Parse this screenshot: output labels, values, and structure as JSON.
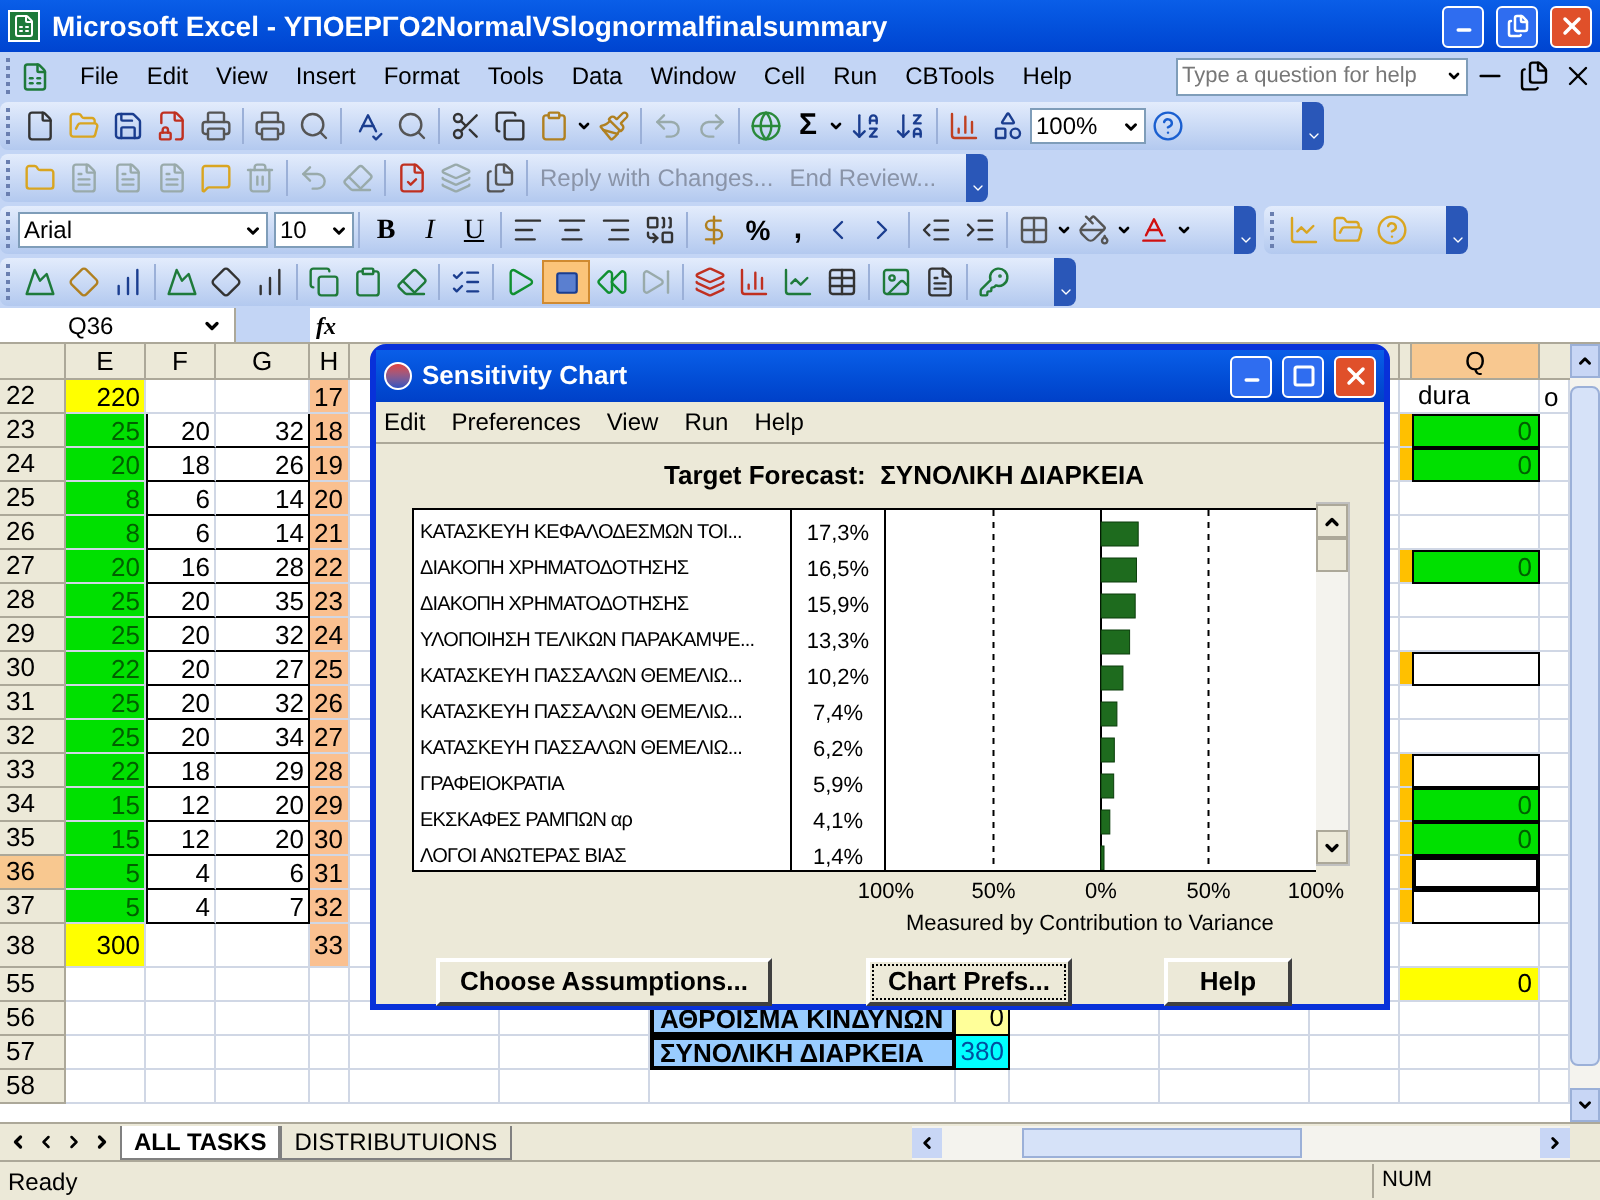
{
  "window": {
    "title": "Microsoft Excel - ΥΠΟΕΡΓΟ2NormalVSlognormalfinalsummary"
  },
  "menu_bar": {
    "items": [
      "File",
      "Edit",
      "View",
      "Insert",
      "Format",
      "Tools",
      "Data",
      "Window",
      "Cell",
      "Run",
      "CBTools",
      "Help"
    ],
    "help_search": {
      "placeholder": "Type a question for help"
    }
  },
  "standard_toolbar": {
    "autosum": "Σ",
    "zoom": "100%"
  },
  "reviewing_toolbar": {
    "reply": "Reply with Changes...",
    "end_review": "End Review..."
  },
  "formatting_toolbar": {
    "font": "Arial",
    "size": "10",
    "style_buttons": [
      "B",
      "I",
      "U"
    ],
    "percent": "%",
    "comma": ","
  },
  "simulation_toolbar": {
    "stop_pressed": true
  },
  "formula_bar": {
    "name_box": "Q36",
    "fx": "fx"
  },
  "sheet": {
    "columns": [
      {
        "label": "E",
        "selected": false
      },
      {
        "label": "F",
        "selected": false
      },
      {
        "label": "G",
        "selected": false
      },
      {
        "label": "H",
        "selected": false
      }
    ],
    "right_columns": [
      {
        "label": "Q",
        "selected": true
      }
    ],
    "rows": [
      {
        "header": "22",
        "selected": false,
        "e": {
          "value": "220",
          "kind": "total"
        },
        "h": "17",
        "q": {
          "kind": "text",
          "value": "dura"
        },
        "r": "o"
      },
      {
        "header": "23",
        "selected": false,
        "e": {
          "value": "25",
          "kind": "task"
        },
        "f": "20",
        "g": "32",
        "h": "18",
        "q": {
          "kind": "green",
          "value": "0"
        }
      },
      {
        "header": "24",
        "selected": false,
        "e": {
          "value": "20",
          "kind": "task"
        },
        "f": "18",
        "g": "26",
        "h": "19",
        "q": {
          "kind": "green",
          "value": "0"
        }
      },
      {
        "header": "25",
        "selected": false,
        "e": {
          "value": "8",
          "kind": "task"
        },
        "f": "6",
        "g": "14",
        "h": "20"
      },
      {
        "header": "26",
        "selected": false,
        "e": {
          "value": "8",
          "kind": "task"
        },
        "f": "6",
        "g": "14",
        "h": "21"
      },
      {
        "header": "27",
        "selected": false,
        "e": {
          "value": "20",
          "kind": "task"
        },
        "f": "16",
        "g": "28",
        "h": "22",
        "q": {
          "kind": "green",
          "value": "0"
        }
      },
      {
        "header": "28",
        "selected": false,
        "e": {
          "value": "25",
          "kind": "task"
        },
        "f": "20",
        "g": "35",
        "h": "23"
      },
      {
        "header": "29",
        "selected": false,
        "e": {
          "value": "25",
          "kind": "task"
        },
        "f": "20",
        "g": "32",
        "h": "24"
      },
      {
        "header": "30",
        "selected": false,
        "e": {
          "value": "22",
          "kind": "task"
        },
        "f": "20",
        "g": "27",
        "h": "25",
        "q": {
          "kind": "box"
        }
      },
      {
        "header": "31",
        "selected": false,
        "e": {
          "value": "25",
          "kind": "task"
        },
        "f": "20",
        "g": "32",
        "h": "26"
      },
      {
        "header": "32",
        "selected": false,
        "e": {
          "value": "25",
          "kind": "task"
        },
        "f": "20",
        "g": "34",
        "h": "27"
      },
      {
        "header": "33",
        "selected": false,
        "e": {
          "value": "22",
          "kind": "task"
        },
        "f": "18",
        "g": "29",
        "h": "28",
        "q": {
          "kind": "box"
        }
      },
      {
        "header": "34",
        "selected": false,
        "e": {
          "value": "15",
          "kind": "task"
        },
        "f": "12",
        "g": "20",
        "h": "29",
        "q": {
          "kind": "green",
          "value": "0"
        }
      },
      {
        "header": "35",
        "selected": false,
        "e": {
          "value": "15",
          "kind": "task"
        },
        "f": "12",
        "g": "20",
        "h": "30",
        "q": {
          "kind": "green",
          "value": "0"
        }
      },
      {
        "header": "36",
        "selected": true,
        "e": {
          "value": "5",
          "kind": "task"
        },
        "f": "4",
        "g": "6",
        "h": "31",
        "q": {
          "kind": "box"
        }
      },
      {
        "header": "37",
        "selected": false,
        "e": {
          "value": "5",
          "kind": "task"
        },
        "f": "4",
        "g": "7",
        "h": "32",
        "q": {
          "kind": "box"
        }
      },
      {
        "header": "38",
        "selected": false,
        "e": {
          "value": "300",
          "kind": "total"
        },
        "h": "33"
      },
      {
        "header": "55",
        "selected": false,
        "q": {
          "kind": "yellow",
          "value": "0"
        }
      },
      {
        "header": "56",
        "selected": false,
        "summary": {
          "label": "ΑΘΡΟΙΣΜΑ ΚΙΝΔΥΝΩΝ",
          "value": "0",
          "kind": "risk"
        }
      },
      {
        "header": "57",
        "selected": false,
        "summary": {
          "label": "ΣΥΝΟΛΙΚΗ ΔΙΑΡΚΕΙΑ",
          "value": "380",
          "kind": "duration"
        }
      },
      {
        "header": "58",
        "selected": false
      }
    ]
  },
  "sheet_tabs": [
    {
      "label": "ALL TASKS",
      "selected": true
    },
    {
      "label": "DISTRIBUTUIONS",
      "selected": false
    }
  ],
  "status_bar": {
    "status": "Ready",
    "num_lock": "NUM"
  },
  "dialog": {
    "title": "Sensitivity Chart",
    "menu": [
      "Edit",
      "Preferences",
      "View",
      "Run",
      "Help"
    ],
    "chart_data": {
      "type": "bar",
      "orientation": "horizontal",
      "title": "Target Forecast:  ΣΥΝΟΛΙΚΗ ΔΙΑΡΚΕΙΑ",
      "xlabel": "Measured by Contribution to Variance",
      "categories": [
        "ΚΑΤΑΣΚΕΥΗ ΚΕΦΑΛΟΔΕΣΜΩΝ ΤΟΙ...",
        "ΔΙΑΚΟΠΗ ΧΡΗΜΑΤΟΔΟΤΗΣΗΣ",
        "ΔΙΑΚΟΠΗ ΧΡΗΜΑΤΟΔΟΤΗΣΗΣ",
        "ΥΛΟΠΟΙΗΣΗ ΤΕΛΙΚΩΝ ΠΑΡΑΚΑΜΨΕ...",
        "ΚΑΤΑΣΚΕΥΗ ΠΑΣΣΑΛΩΝ ΘΕΜΕΛΙΩ...",
        "ΚΑΤΑΣΚΕΥΗ ΠΑΣΣΑΛΩΝ ΘΕΜΕΛΙΩ...",
        "ΚΑΤΑΣΚΕΥΗ ΠΑΣΣΑΛΩΝ ΘΕΜΕΛΙΩ...",
        "ΓΡΑΦΕΙΟΚΡΑΤΙΑ",
        "ΕΚΣΚΑΦΕΣ ΡΑΜΠΩΝ αρ",
        "ΛΟΓΟΙ ΑΝΩΤΕΡΑΣ ΒΙΑΣ"
      ],
      "series": [
        {
          "color": "#1e6b1e",
          "values": [
            17.3,
            16.5,
            15.9,
            13.3,
            10.2,
            7.4,
            6.2,
            5.9,
            4.1,
            1.4
          ]
        }
      ],
      "xlim": [
        -100,
        100
      ],
      "value_labels": [
        "17,3%",
        "16,5%",
        "15,9%",
        "13,3%",
        "10,2%",
        "7,4%",
        "6,2%",
        "5,9%",
        "4,1%",
        "1,4%"
      ],
      "xticks": [
        {
          "value": -100,
          "label": "100%"
        },
        {
          "value": -50,
          "label": "50%"
        },
        {
          "value": 0,
          "label": "0%"
        },
        {
          "value": 50,
          "label": "50%"
        },
        {
          "value": 100,
          "label": "100%"
        }
      ]
    },
    "buttons": [
      {
        "label": "Choose Assumptions...",
        "focused": false
      },
      {
        "label": "Chart Prefs...",
        "focused": true
      },
      {
        "label": "Help",
        "focused": false
      }
    ]
  }
}
